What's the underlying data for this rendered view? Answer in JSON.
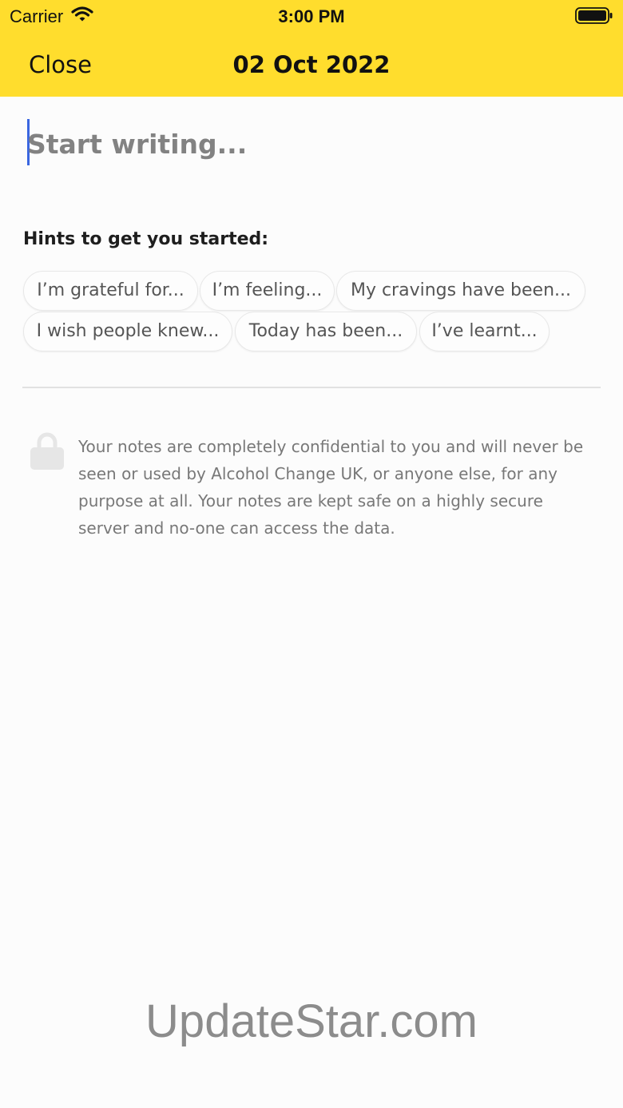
{
  "status_bar": {
    "carrier": "Carrier",
    "time": "3:00 PM"
  },
  "nav": {
    "close_label": "Close",
    "title": "02 Oct 2022"
  },
  "editor": {
    "placeholder": "Start writing..."
  },
  "hints": {
    "heading": "Hints to get you started:",
    "chips": [
      "I’m grateful for...",
      "I’m feeling...",
      "My cravings have been...",
      "I wish people knew...",
      "Today has been...",
      "I’ve learnt..."
    ]
  },
  "privacy": {
    "icon": "lock-icon",
    "text": "Your notes are completely confidential to you and will never be seen or used by Alcohol Change UK, or anyone else, for any purpose at all. Your notes are kept safe on a highly secure server and no-one can access the data."
  },
  "watermark": "UpdateStar.com",
  "colors": {
    "header": "#ffdd2d",
    "caret": "#3a66e0"
  }
}
